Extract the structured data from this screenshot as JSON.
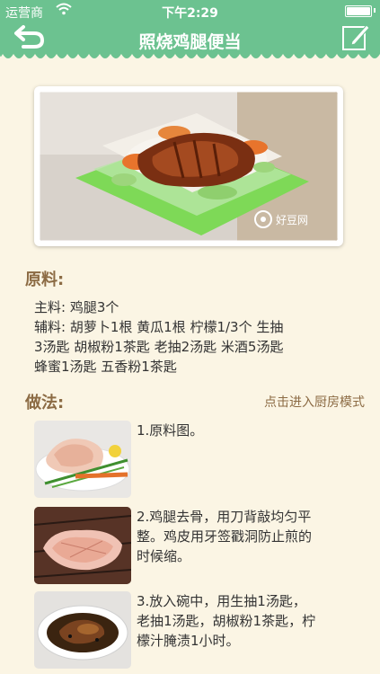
{
  "status": {
    "carrier": "运营商",
    "time": "下午2:29"
  },
  "nav": {
    "title": "照烧鸡腿便当",
    "back_icon": "back-arrow-icon",
    "edit_icon": "edit-icon"
  },
  "colors": {
    "header": "#6cc290",
    "background": "#fbf5e4",
    "accent": "#8c6b44"
  },
  "hero": {
    "watermark": "好豆网"
  },
  "ingredients": {
    "heading": "原料:",
    "main": "主料: 鸡腿3个",
    "aux_lines": [
      "辅料: 胡萝卜1根  黄瓜1根  柠檬1/3个  生抽",
      "3汤匙  胡椒粉1茶匙  老抽2汤匙  米酒5汤匙",
      "蜂蜜1汤匙  五香粉1茶匙"
    ]
  },
  "method": {
    "heading": "做法:",
    "kitchen_mode": "点击进入厨房模式",
    "steps": [
      {
        "lines": [
          "1.原料图。"
        ]
      },
      {
        "lines": [
          "2.鸡腿去骨，用刀背敲均匀平",
          "整。鸡皮用牙签戳洞防止煎的",
          "时候缩。"
        ]
      },
      {
        "lines": [
          "3.放入碗中，用生抽1汤匙，",
          "老抽1汤匙，胡椒粉1茶匙，柠",
          "檬汁腌渍1小时。"
        ]
      }
    ]
  }
}
